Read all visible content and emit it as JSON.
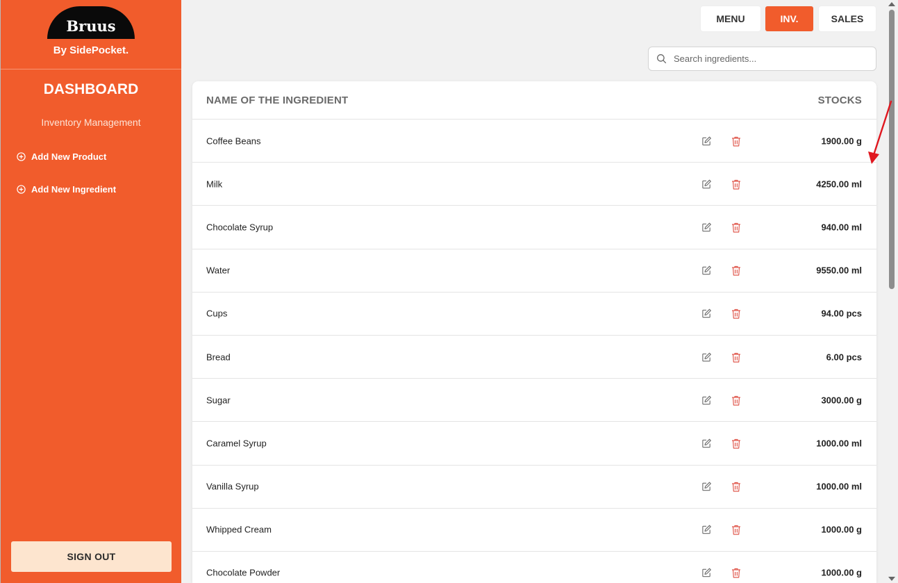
{
  "sidebar": {
    "logo_text": "Bruus",
    "byline": "By SidePocket.",
    "title": "DASHBOARD",
    "subtitle": "Inventory Management",
    "links": [
      {
        "label": "Add New Product",
        "icon": "plus-circle-icon"
      },
      {
        "label": "Add New Ingredient",
        "icon": "plus-circle-icon"
      }
    ],
    "signout_label": "SIGN OUT"
  },
  "nav": {
    "menu_label": "MENU",
    "inv_label": "INV.",
    "sales_label": "SALES",
    "active": "INV."
  },
  "search": {
    "placeholder": "Search ingredients...",
    "value": ""
  },
  "table": {
    "col_name": "NAME OF THE INGREDIENT",
    "col_stock": "STOCKS",
    "rows": [
      {
        "name": "Coffee Beans",
        "stock": "1900.00 g"
      },
      {
        "name": "Milk",
        "stock": "4250.00 ml"
      },
      {
        "name": "Chocolate Syrup",
        "stock": "940.00 ml"
      },
      {
        "name": "Water",
        "stock": "9550.00 ml"
      },
      {
        "name": "Cups",
        "stock": "94.00 pcs"
      },
      {
        "name": "Bread",
        "stock": "6.00 pcs"
      },
      {
        "name": "Sugar",
        "stock": "3000.00 g"
      },
      {
        "name": "Caramel Syrup",
        "stock": "1000.00 ml"
      },
      {
        "name": "Vanilla Syrup",
        "stock": "1000.00 ml"
      },
      {
        "name": "Whipped Cream",
        "stock": "1000.00 g"
      },
      {
        "name": "Chocolate Powder",
        "stock": "1000.00 g"
      }
    ],
    "row_icons": [
      "edit-icon",
      "trash-icon"
    ]
  },
  "colors": {
    "brand": "#f15c2c",
    "signout_bg": "#fde5cf",
    "delete_red": "#e05a4f",
    "annotation_arrow": "#e0171f"
  }
}
